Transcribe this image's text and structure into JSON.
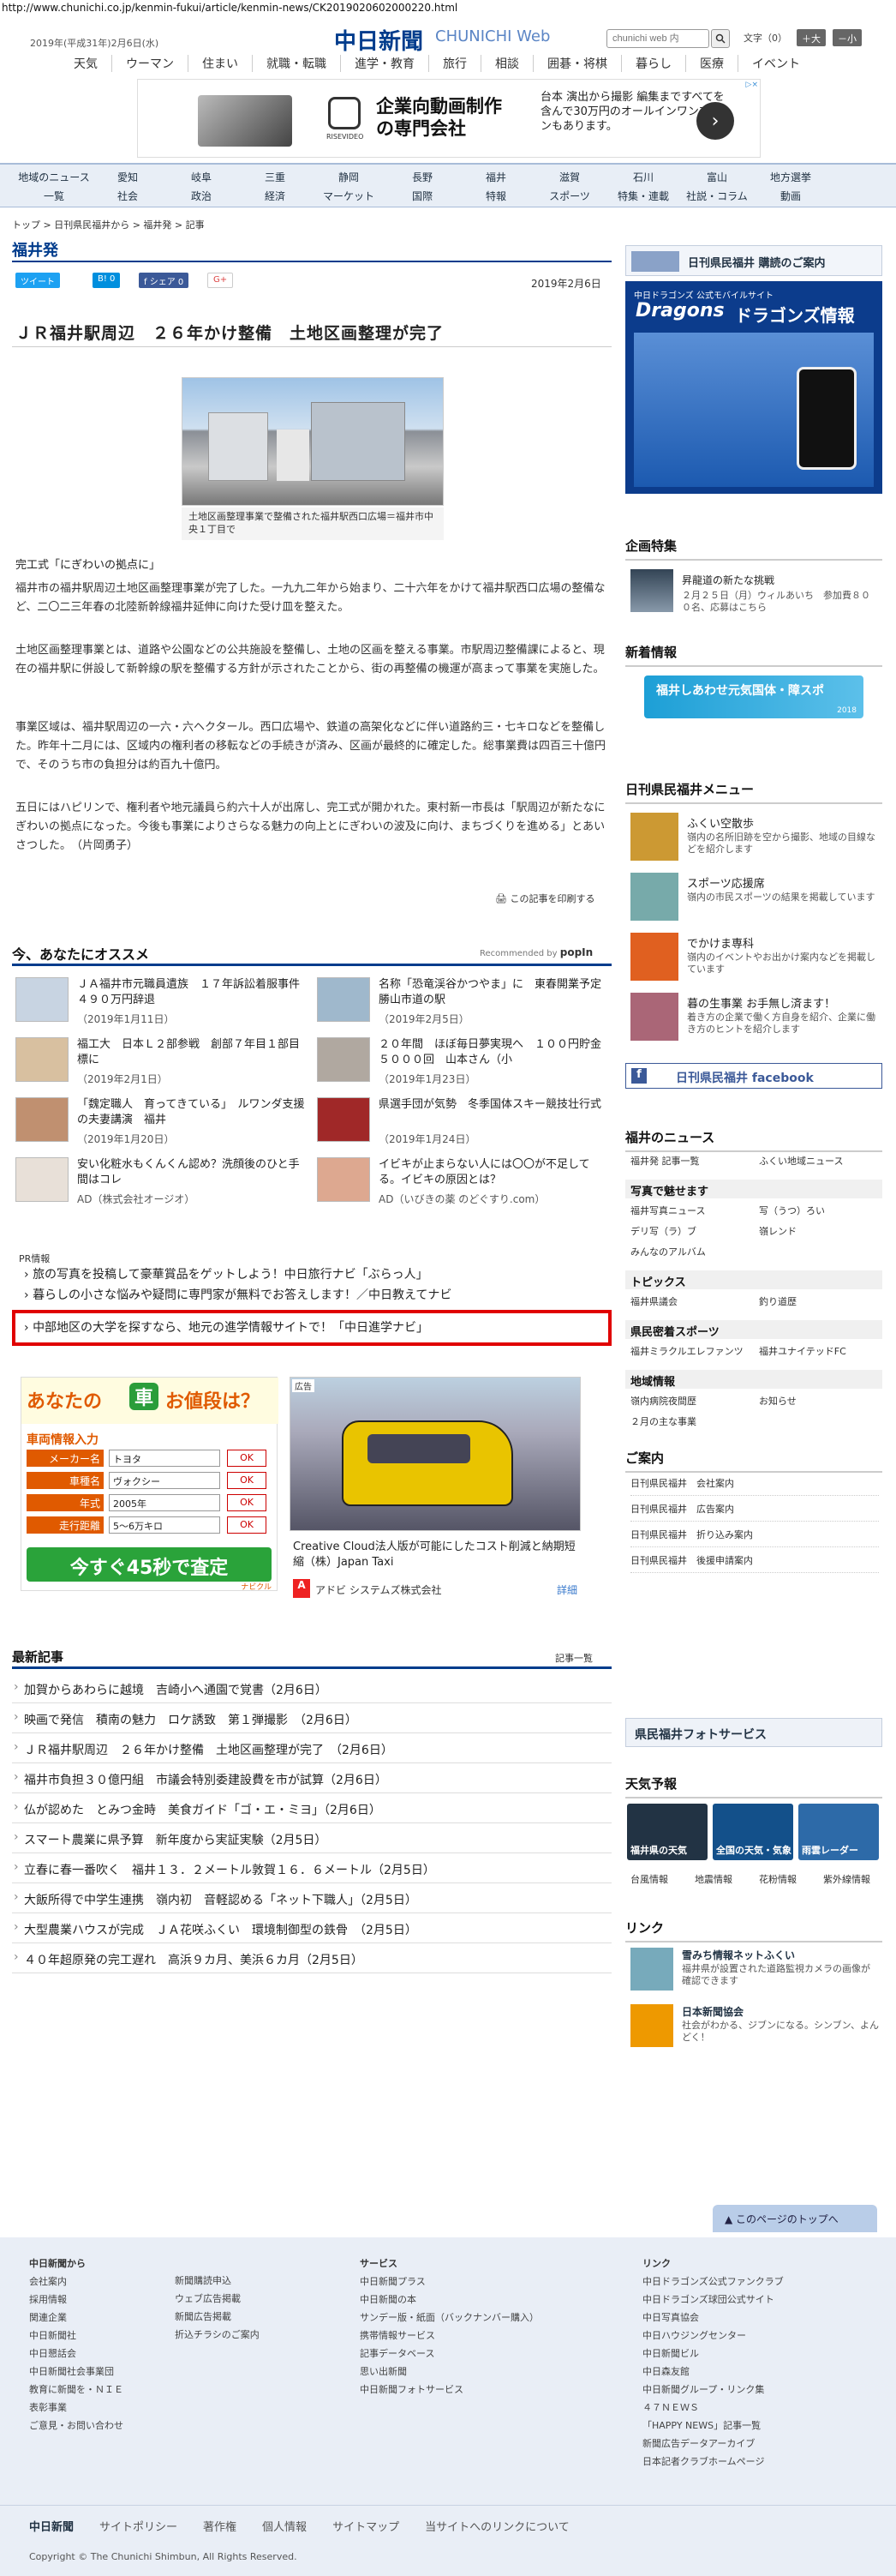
{
  "browser": {
    "url": "http://www.chunichi.co.jp/kenmin-fukui/article/kenmin-news/CK2019020602000220.html"
  },
  "header": {
    "date": "2019年(平成31年)2月6日(水)",
    "logo": "中日新聞",
    "logo_sub": "CHUNICHI Web",
    "search_placeholder": "chunichi web 内",
    "font_label": "文字（0）",
    "font_up": "＋大",
    "font_down": "－小"
  },
  "gnav": [
    "天気",
    "ウーマン",
    "住まい",
    "就職・転職",
    "進学・教育",
    "旅行",
    "相談",
    "囲碁・将棋",
    "暮らし",
    "医療",
    "イベント"
  ],
  "ad1": {
    "badge": "▷×",
    "brand": "RISEVIDEO",
    "headline1": "企業向動画制作",
    "headline2": "の専門会社",
    "desc": "台本 演出から撮影 編集まですべてを含んで30万円のオールインワンプランもあります。",
    "arrow": "›"
  },
  "cnav": {
    "row1": [
      "地域のニュース",
      "愛知",
      "岐阜",
      "三重",
      "静岡",
      "長野",
      "福井",
      "滋賀",
      "石川",
      "富山",
      "地方選挙"
    ],
    "row2": [
      "一覧",
      "社会",
      "政治",
      "経済",
      "マーケット",
      "国際",
      "特報",
      "スポーツ",
      "特集・連載",
      "社説・コラム",
      "動画"
    ]
  },
  "breadcrumb": "トップ > 日刊県民福井から > 福井発 > 記事",
  "section": "福井発",
  "share": {
    "tweet": "ツイート",
    "hatena": "B! 0",
    "fb": "f シェア 0",
    "g": "G+"
  },
  "article": {
    "date": "2019年2月6日",
    "title": "ＪＲ福井駅周辺　２６年かけ整備　土地区画整理が完了",
    "caption": "土地区画整理事業で整備された福井駅西口広場＝福井市中央１丁目で",
    "subhead": "完工式「にぎわいの拠点に」",
    "paragraphs": [
      "福井市の福井駅周辺土地区画整理事業が完了した。一九九二年から始まり、二十六年をかけて福井駅西口広場の整備など、二〇二三年春の北陸新幹線福井延伸に向けた受け皿を整えた。",
      "土地区画整理事業とは、道路や公園などの公共施設を整備し、土地の区画を整える事業。市駅周辺整備課によると、現在の福井駅に併設して新幹線の駅を整備する方針が示されたことから、街の再整備の機運が高まって事業を実施した。",
      "事業区域は、福井駅周辺の一六・六ヘクタール。西口広場や、鉄道の高架化などに伴い道路約三・七キロなどを整備した。昨年十二月には、区域内の権利者の移転などの手続きが済み、区画が最終的に確定した。総事業費は四百三十億円で、そのうち市の負担分は約百九十億円。",
      "五日にはハピリンで、権利者や地元議員ら約六十人が出席し、完工式が開かれた。東村新一市長は「駅周辺が新たなにぎわいの拠点になった。今後も事業によりさらなる魅力の向上とにぎわいの波及に向け、まちづくりを進める」とあいさつした。　（片岡勇子）"
    ],
    "print": "この記事を印刷する"
  },
  "recommend": {
    "title": "今、あなたにオススメ",
    "by": "Recommended by",
    "by_brand": "popIn",
    "items": [
      {
        "title": "ＪＡ福井市元職員遺族　１７年訴訟着服事件　４９０万円辞退",
        "date": "（2019年1月11日）"
      },
      {
        "title": "名称「恐竜渓谷かつやま」に　東春開業予定　勝山市道の駅",
        "date": "（2019年2月5日）"
      },
      {
        "title": "福工大　日本Ｌ２部参戦　創部７年目１部目標に",
        "date": "（2019年2月1日）"
      },
      {
        "title": "２０年間　ほぼ毎日夢実現へ　１００円貯金５０００回　山本さん（小",
        "date": "（2019年1月23日）"
      },
      {
        "title": "「魏定職人　育ってきている」　ルワンダ支援の夫妻講演　福井",
        "date": "（2019年1月20日）"
      },
      {
        "title": "県選手団が気勢　冬季国体スキー競技壮行式",
        "date": "（2019年1月24日）"
      },
      {
        "title": "安い化粧水もくんくん認め？洗顔後のひと手間はコレ",
        "date": "AD（株式会社オージオ）"
      },
      {
        "title": "イビキが止まらない人には〇〇が不足してる。イビキの原因とは？",
        "date": "AD（いびきの薬 のどぐすり.com）"
      }
    ]
  },
  "pr": {
    "label": "PR情報",
    "links": [
      "旅の写真を投稿して豪華賞品をゲットしよう！中日旅行ナビ「ぶらっ人」",
      "暮らしの小さな悩みや疑問に専門家が無料でお答えします！／中日教えてナビ",
      "中部地区の大学を探すなら、地元の進学情報サイトで！「中日進学ナビ」"
    ]
  },
  "ad2": {
    "title": "あなたの",
    "title2": "お値段は？",
    "sub": "車両情報入力",
    "rows": [
      {
        "k": "メーカー名",
        "v": "トヨタ"
      },
      {
        "k": "車種名",
        "v": "ヴォクシー"
      },
      {
        "k": "年式",
        "v": "2005年"
      },
      {
        "k": "走行距離",
        "v": "5～6万キロ"
      }
    ],
    "ok": "OK",
    "cta": "今すぐ45秒で査定",
    "brand": "ナビクル"
  },
  "ad3": {
    "label": "広告",
    "text": "Creative Cloud法人版が可能にしたコスト削減と納期短縮（株）Japan Taxi",
    "company": "アドビ システムズ株式会社",
    "more": "詳細"
  },
  "latest": {
    "title": "最新記事",
    "more": "記事一覧",
    "items": [
      "加賀からあわらに越境　吉崎小へ通園で覚書（2月6日）",
      "映画で発信　積南の魅力　ロケ誘致　第１弾撮影　（2月6日）",
      "ＪＲ福井駅周辺　２６年かけ整備　土地区画整理が完了　（2月6日）",
      "福井市負担３０億円組　市議会特別委建設費を市が試算（2月6日）",
      "仏が認めた　とみつ金時　美食ガイド「ゴ・エ・ミヨ」（2月6日）",
      "スマート農業に県予算　新年度から実証実験（2月5日）",
      "立春に春一番吹く　福井１３．２メートル敦賀１６．６メートル（2月5日）",
      "大飯所得で中学生連携　嶺内初　音軽認める「ネット下職人」（2月5日）",
      "大型農業ハウスが完成　ＪＡ花咲ふくい　環境制御型の鉄骨　（2月5日）",
      "４０年超原発の完工遅れ　高浜９カ月、美浜６カ月（2月5日）"
    ]
  },
  "sidebar": {
    "kodoku": "日刊県民福井 購読のご案内",
    "dragons": {
      "head": "中日ドラゴンズ 公式モバイルサイト",
      "title": "ドラゴンズ情報",
      "brand": "Dragons"
    },
    "kikaku": {
      "title": "企画特集",
      "item": "昇龍道の新たな挑戦",
      "desc": "２月２５日（月）ウィルあいち　参加費８００名、応募はこちら"
    },
    "shinchaku": {
      "title": "新着情報",
      "banner": "福井しあわせ元気国体・障スポ",
      "year": "2018"
    },
    "menu": {
      "title": "日刊県民福井メニュー",
      "items": [
        {
          "t": "ふくい空散歩",
          "d": "嶺内の名所旧跡を空から撮影、地域の目線などを紹介します"
        },
        {
          "t": "スポーツ応援席",
          "d": "嶺内の市民スポーツの結果を掲載しています"
        },
        {
          "t": "でかけま専科",
          "d": "嶺内のイベントやお出かけ案内などを掲載しています"
        },
        {
          "t": "暮の生事業 お手無し済ます！",
          "d": "着き方の企業で働く方自身を紹介、企業に働き方のヒントを紹介します"
        }
      ]
    },
    "fb": "日刊県民福井 facebook",
    "news": {
      "title": "福井のニュース",
      "links": [
        "福井発 記事一覧",
        "ふくい地域ニュース"
      ]
    },
    "photo": {
      "title": "写真で魅せます",
      "links": [
        "福井写真ニュース",
        "写（うつ）ろい",
        "デリ写（ラ）ブ",
        "嶺レンド",
        "みんなのアルバム"
      ]
    },
    "topics": {
      "title": "トピックス",
      "links": [
        "福井県議会",
        "釣り道歴"
      ]
    },
    "sports": {
      "title": "県民密着スポーツ",
      "links": [
        "福井ミラクルエレファンツ",
        "福井ユナイテッドFC"
      ]
    },
    "local": {
      "title": "地域情報",
      "links": [
        "嶺内病院夜間歴",
        "お知らせ",
        "２月の主な事業"
      ]
    },
    "guide": {
      "title": "ご案内",
      "links": [
        "日刊県民福井　会社案内",
        "日刊県民福井　広告案内",
        "日刊県民福井　折り込み案内",
        "日刊県民福井　後援申請案内"
      ]
    },
    "photoservice": "県民福井フォトサービス",
    "tenki": {
      "title": "天気予報",
      "cards": [
        "福井県の天気",
        "全国の天気・気象",
        "雨雲レーダー"
      ],
      "links": [
        "台風情報",
        "地震情報",
        "花粉情報",
        "紫外線情報"
      ]
    },
    "link": {
      "title": "リンク",
      "items": [
        {
          "t": "雪みち情報ネットふくい",
          "d": "福井県が設置された道路監視カメラの画像が確認できます"
        },
        {
          "t": "日本新聞協会",
          "d": "社会がわかる、ジブンになる。シンブン、よんどく！"
        }
      ]
    }
  },
  "footer": {
    "totop": "このページのトップへ",
    "col1_title": "中日新聞から",
    "col1": [
      "会社案内",
      "採用情報",
      "関連企業",
      "中日新聞社",
      "中日懇話会",
      "中日新聞社会事業団",
      "教育に新聞を・ＮＩＥ",
      "表彰事業",
      "ご意見・お問い合わせ"
    ],
    "col2": [
      "新聞購読申込",
      "ウェブ広告掲載",
      "新聞広告掲載",
      "折込チラシのご案内"
    ],
    "col3_title": "サービス",
    "col3": [
      "中日新聞プラス",
      "中日新聞の本",
      "サンデー版・紙面（バックナンバー購入）",
      "携帯情報サービス",
      "記事データベース",
      "思い出新聞",
      "中日新聞フォトサービス"
    ],
    "col4_title": "リンク",
    "col4": [
      "中日ドラゴンズ公式ファンクラブ",
      "中日ドラゴンズ球団公式サイト",
      "中日写真協会",
      "中日ハウジングセンター",
      "中日新聞ビル",
      "中日森友館",
      "中日新聞グループ・リンク集",
      "４７ＮＥＷＳ",
      "「HAPPY NEWS」記事一覧",
      "新聞広告データアーカイブ",
      "日本記者クラブホームページ"
    ],
    "bar": [
      "中日新聞",
      "サイトポリシー",
      "著作権",
      "個人情報",
      "サイトマップ",
      "当サイトへのリンクについて"
    ],
    "copy": "Copyright © The Chunichi Shimbun, All Rights Reserved."
  },
  "colors": {
    "brand": "#003c8c",
    "accent_red": "#e00000",
    "light_blue": "#e8eef6"
  }
}
